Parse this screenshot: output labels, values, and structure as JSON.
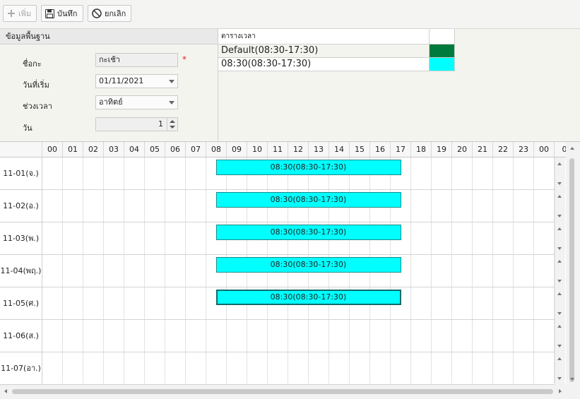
{
  "toolbar": {
    "add_label": "เพิ่ม",
    "save_label": "บันทึก",
    "cancel_label": "ยกเลิก"
  },
  "form": {
    "header": "ข้อมูลพื้นฐาน",
    "shift_name_label": "ชื่อกะ",
    "shift_name_value": "กะเช้า",
    "required_mark": "*",
    "start_date_label": "วันที่เริ่ม",
    "start_date_value": "01/11/2021",
    "period_label": "ช่วงเวลา",
    "period_value": "อาทิตย์",
    "days_label": "วัน",
    "days_value": "1"
  },
  "schedule_list": {
    "header": "ตารางเวลา",
    "items": [
      {
        "name": "Default(08:30-17:30)",
        "color": "#007a3d"
      },
      {
        "name": "08:30(08:30-17:30)",
        "color": "#00ffff"
      }
    ]
  },
  "timeline": {
    "hours": [
      "00",
      "01",
      "02",
      "03",
      "04",
      "05",
      "06",
      "07",
      "08",
      "09",
      "10",
      "11",
      "12",
      "13",
      "14",
      "15",
      "16",
      "17",
      "18",
      "19",
      "20",
      "21",
      "22",
      "23",
      "00",
      "0"
    ],
    "rows": [
      {
        "label": "11-01(จ.)",
        "bar": "08:30(08:30-17:30)",
        "start": 8.5,
        "end": 17.5
      },
      {
        "label": "11-02(อ.)",
        "bar": "08:30(08:30-17:30)",
        "start": 8.5,
        "end": 17.5
      },
      {
        "label": "11-03(พ.)",
        "bar": "08:30(08:30-17:30)",
        "start": 8.5,
        "end": 17.5
      },
      {
        "label": "11-04(พฤ.)",
        "bar": "08:30(08:30-17:30)",
        "start": 8.5,
        "end": 17.5
      },
      {
        "label": "11-05(ศ.)",
        "bar": "08:30(08:30-17:30)",
        "start": 8.5,
        "end": 17.5,
        "active": true
      },
      {
        "label": "11-06(ส.)",
        "bar": null
      },
      {
        "label": "11-07(อา.)",
        "bar": null
      }
    ],
    "bar_color": "#00ffff"
  }
}
